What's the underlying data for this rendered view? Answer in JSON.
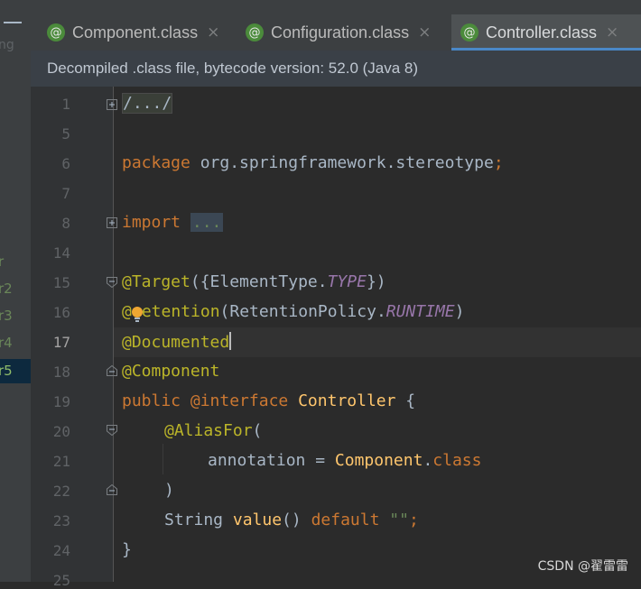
{
  "project_panel": {
    "items": [
      "r",
      "r2",
      "r3",
      "r4",
      "r5"
    ],
    "selected_index": 4,
    "muted_text": "ng"
  },
  "tabs": [
    {
      "icon": "@",
      "label": "Component.class",
      "close": "×",
      "active": false
    },
    {
      "icon": "@",
      "label": "Configuration.class",
      "close": "×",
      "active": false
    },
    {
      "icon": "@",
      "label": "Controller.class",
      "close": "×",
      "active": true
    }
  ],
  "notification": "Decompiled .class file, bytecode version: 52.0 (Java 8)",
  "editor": {
    "current_line": "17",
    "lines": [
      {
        "no": "1"
      },
      {
        "no": "5"
      },
      {
        "no": "6"
      },
      {
        "no": "7"
      },
      {
        "no": "8"
      },
      {
        "no": "14"
      },
      {
        "no": "15"
      },
      {
        "no": "16"
      },
      {
        "no": "17"
      },
      {
        "no": "18"
      },
      {
        "no": "19"
      },
      {
        "no": "20"
      },
      {
        "no": "21"
      },
      {
        "no": "22"
      },
      {
        "no": "23"
      },
      {
        "no": "24"
      },
      {
        "no": "25"
      }
    ],
    "code": {
      "l1": "/.../",
      "l6_kw": "package",
      "l6_rest": " org.springframework.stereotype",
      "l6_semi": ";",
      "l8_kw": "import",
      "l8_fold": "...",
      "l15_an": "@Target",
      "l15_a": "({ElementType.",
      "l15_it": "TYPE",
      "l15_b": "})",
      "l16_an_a": "@",
      "l16_an_b": "etention",
      "l16_a": "(RetentionPolicy.",
      "l16_it": "RUNTIME",
      "l16_b": ")",
      "l17_an": "@Documented",
      "l18_an": "@Component",
      "l19_kw": "public",
      "l19_an": "@interface",
      "l19_name": "Controller",
      "l19_b": " {",
      "l20_an": "@AliasFor",
      "l20_b": "(",
      "l21_a": "annotation = ",
      "l21_cls": "Component",
      "l21_dot": ".",
      "l21_kw": "class",
      "l22": ")",
      "l23_type": "String ",
      "l23_fn": "value",
      "l23_b": "() ",
      "l23_kw": "default",
      "l23_str": "\"\"",
      "l23_semi": ";",
      "l24": "}"
    }
  },
  "watermark": "CSDN @翟雷雷",
  "colors": {
    "background": "#2b2b2b",
    "keyword": "#cc7832",
    "annotation": "#bbb529",
    "constant": "#9876aa",
    "string": "#6a8759",
    "function": "#ffc66d",
    "tab_accent": "#4a88c7"
  }
}
